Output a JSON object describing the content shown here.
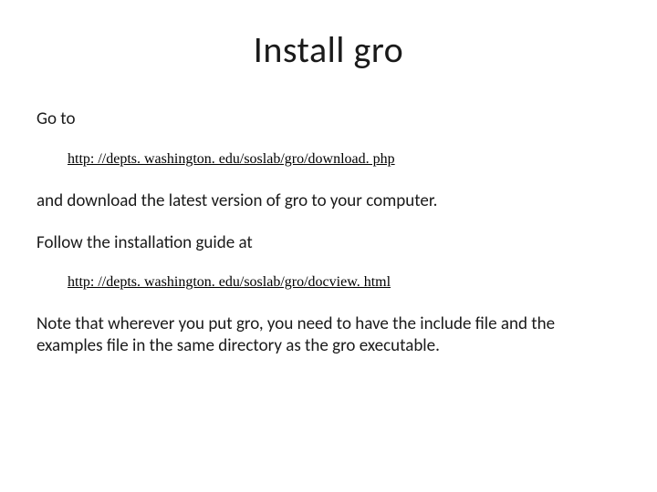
{
  "title": "Install gro",
  "body": {
    "goto": "Go to",
    "link1": "http: //depts. washington. edu/soslab/gro/download. php",
    "download_line": "and download the latest version of gro to your computer.",
    "follow_line": "Follow the installation guide at",
    "link2": "http: //depts. washington. edu/soslab/gro/docview. html",
    "note": "Note that wherever you put gro, you need to have the include file and the examples file in the same directory as the gro executable."
  }
}
